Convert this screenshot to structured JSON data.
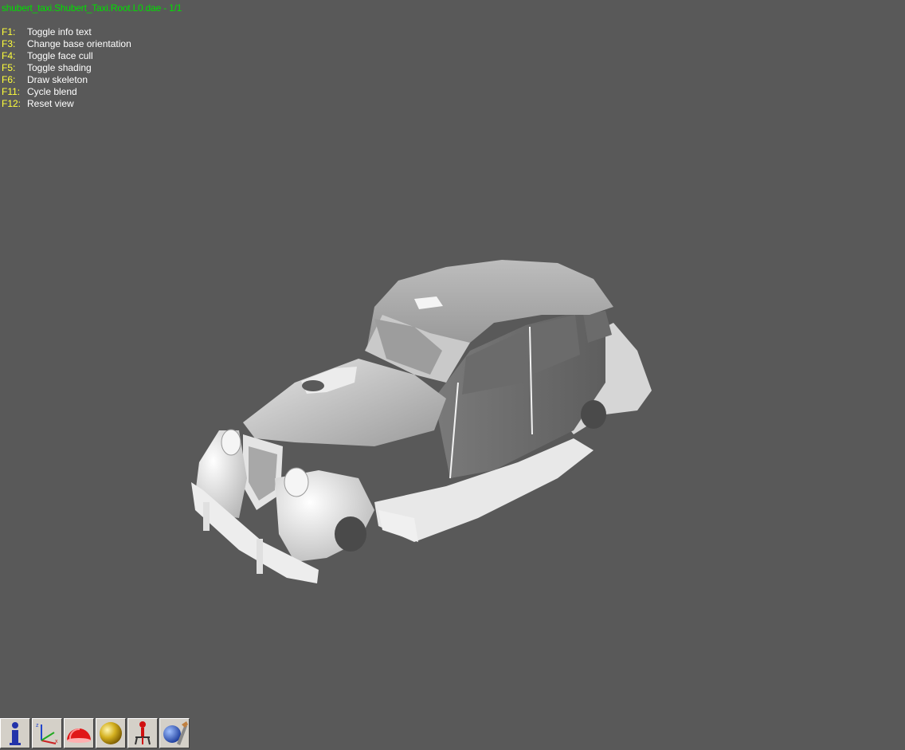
{
  "window": {
    "title": "shubert_taxi.Shubert_Taxi.Root.L0.dae - 1/1",
    "background": "#595959"
  },
  "help": [
    {
      "key": "F1:",
      "action": "Toggle info text"
    },
    {
      "key": "F3:",
      "action": "Change base orientation"
    },
    {
      "key": "F4:",
      "action": "Toggle face cull"
    },
    {
      "key": "F5:",
      "action": "Toggle shading"
    },
    {
      "key": "F6:",
      "action": "Draw skeleton"
    },
    {
      "key": "F11:",
      "action": "Cycle blend"
    },
    {
      "key": "F12:",
      "action": "Reset view"
    }
  ],
  "colors": {
    "title": "#00e000",
    "key": "#ffff3a",
    "text": "#ffffff",
    "model": "#d8d8d8"
  },
  "toolbar": [
    {
      "name": "info-icon"
    },
    {
      "name": "axes-icon"
    },
    {
      "name": "red-hemisphere-icon"
    },
    {
      "name": "gold-sphere-icon"
    },
    {
      "name": "skeleton-figure-icon"
    },
    {
      "name": "globe-brush-icon"
    }
  ]
}
